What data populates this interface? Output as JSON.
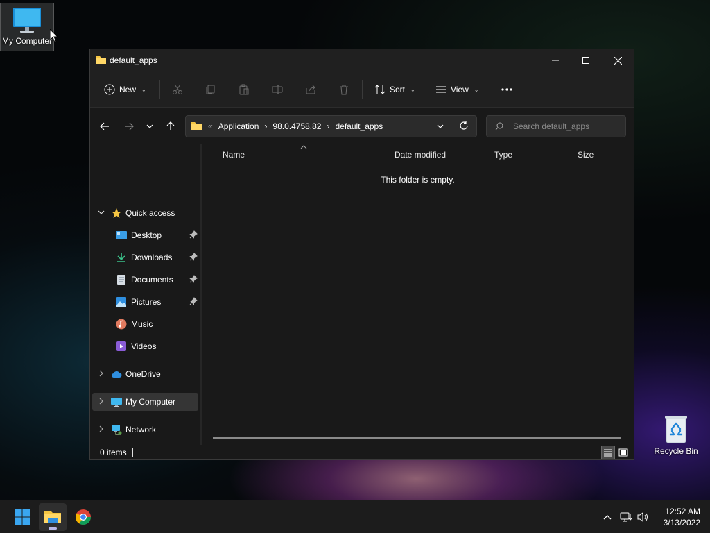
{
  "desktop": {
    "icons": [
      {
        "label": "My Computer"
      },
      {
        "label": "Recycle Bin"
      }
    ]
  },
  "window": {
    "title": "default_apps",
    "toolbar": {
      "new_label": "New",
      "sort_label": "Sort",
      "view_label": "View"
    },
    "address": {
      "overflow": "«",
      "crumbs": [
        "Application",
        "98.0.4758.82",
        "default_apps"
      ]
    },
    "search": {
      "placeholder": "Search default_apps"
    },
    "sidebar": {
      "quick_access": "Quick access",
      "items": [
        {
          "label": "Desktop"
        },
        {
          "label": "Downloads"
        },
        {
          "label": "Documents"
        },
        {
          "label": "Pictures"
        },
        {
          "label": "Music"
        },
        {
          "label": "Videos"
        }
      ],
      "onedrive": "OneDrive",
      "my_computer": "My Computer",
      "network": "Network"
    },
    "columns": [
      "Name",
      "Date modified",
      "Type",
      "Size"
    ],
    "empty_message": "This folder is empty.",
    "status": {
      "item_count": "0 items"
    }
  },
  "taskbar": {
    "time": "12:52 AM",
    "date": "3/13/2022"
  },
  "colors": {
    "accent": "#60cdff",
    "folder": "#f4c542",
    "window_bg": "#191919",
    "titlebar_bg": "#202020"
  }
}
